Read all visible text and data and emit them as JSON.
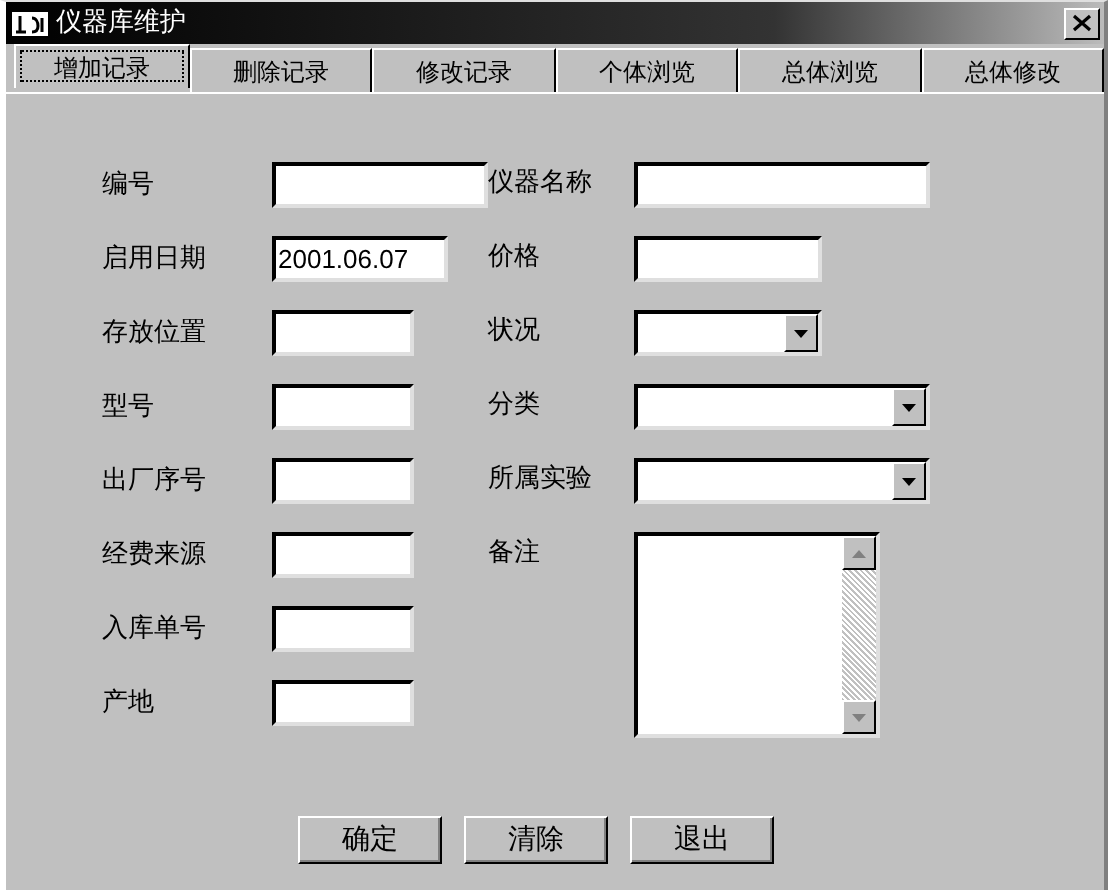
{
  "window": {
    "title": "仪器库维护"
  },
  "tabs": [
    {
      "label": "增加记录",
      "selected": true
    },
    {
      "label": "删除记录",
      "selected": false
    },
    {
      "label": "修改记录",
      "selected": false
    },
    {
      "label": "个体浏览",
      "selected": false
    },
    {
      "label": "总体浏览",
      "selected": false
    },
    {
      "label": "总体修改",
      "selected": false
    }
  ],
  "left_fields": [
    {
      "label": "编号",
      "kind": "text"
    },
    {
      "label": "启用日期",
      "kind": "text",
      "value": "2001.06.07"
    },
    {
      "label": "存放位置",
      "kind": "text"
    },
    {
      "label": "型号",
      "kind": "text"
    },
    {
      "label": "出厂序号",
      "kind": "text"
    },
    {
      "label": "经费来源",
      "kind": "text"
    },
    {
      "label": "入库单号",
      "kind": "text"
    },
    {
      "label": "产地",
      "kind": "text"
    }
  ],
  "right_fields": [
    {
      "label": "仪器名称",
      "kind": "text"
    },
    {
      "label": "价格",
      "kind": "text"
    },
    {
      "label": "状况",
      "kind": "combo"
    },
    {
      "label": "分类",
      "kind": "combo"
    },
    {
      "label": "所属实验",
      "kind": "combo"
    },
    {
      "label": "备注",
      "kind": "memo"
    }
  ],
  "buttons": [
    "确定",
    "清除",
    "退出"
  ]
}
